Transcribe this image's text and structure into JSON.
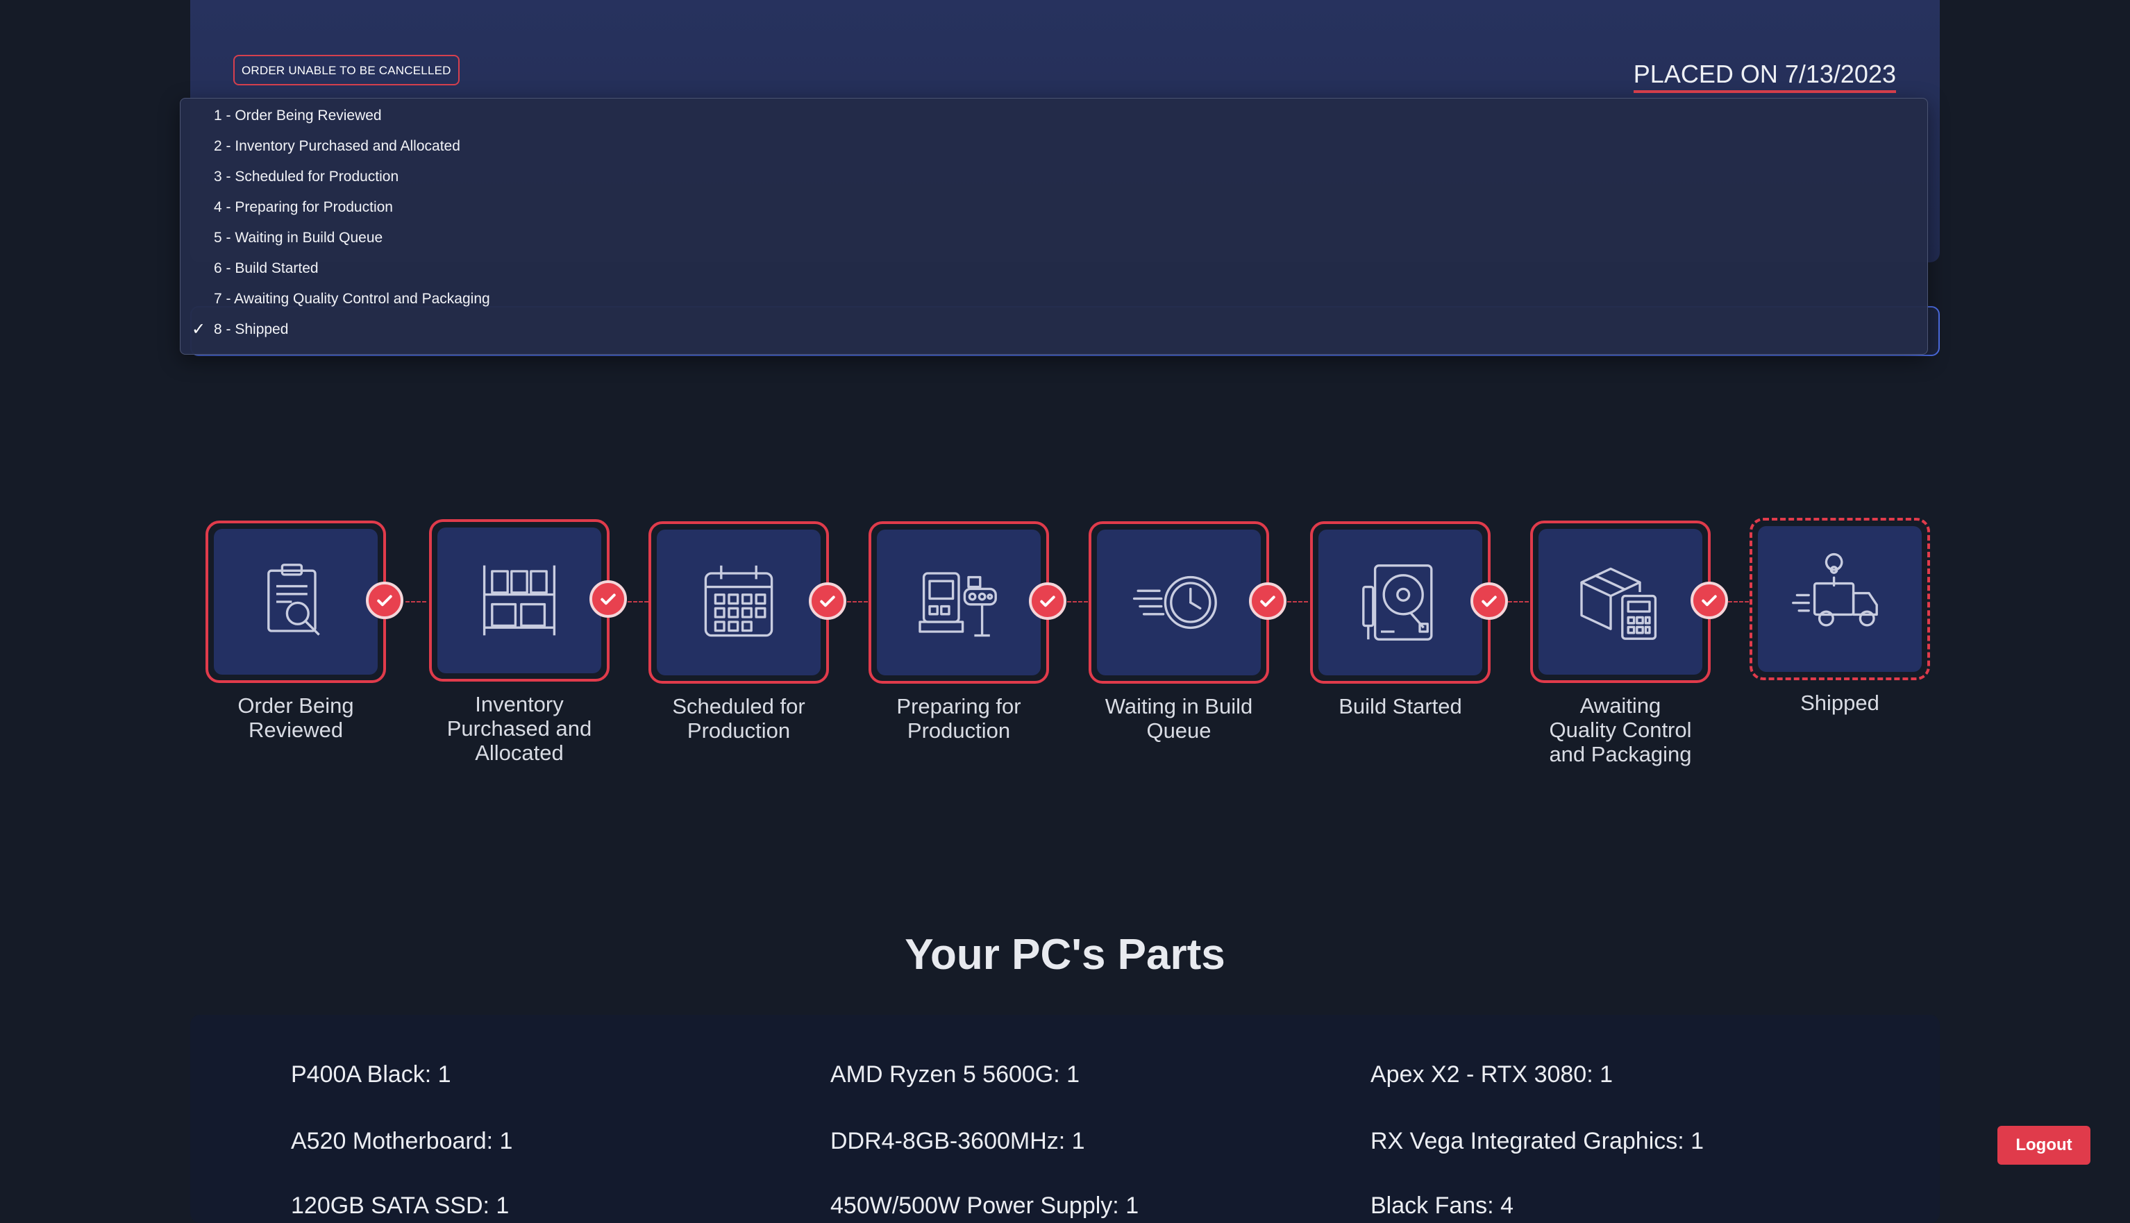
{
  "order": {
    "cancel_badge": "ORDER UNABLE TO BE CANCELLED",
    "placed_on": "PLACED ON 7/13/2023"
  },
  "dropdown": {
    "options": [
      "1 - Order Being Reviewed",
      "2 - Inventory Purchased and Allocated",
      "3 - Scheduled for Production",
      "4 - Preparing for Production",
      "5 - Waiting in Build Queue",
      "6 - Build Started",
      "7 - Awaiting Quality Control and Packaging",
      "8 - Shipped"
    ],
    "selected": "8 - Shipped",
    "check_glyph": "✓"
  },
  "steps": [
    {
      "label_lines": [
        "Order Being",
        "Reviewed"
      ],
      "icon": "clipboard-search-icon",
      "complete": true
    },
    {
      "label_lines": [
        "Inventory",
        "Purchased and",
        "Allocated"
      ],
      "icon": "warehouse-shelf-icon",
      "complete": true
    },
    {
      "label_lines": [
        "Scheduled for",
        "Production"
      ],
      "icon": "calendar-icon",
      "complete": true
    },
    {
      "label_lines": [
        "Preparing for",
        "Production"
      ],
      "icon": "machine-icon",
      "complete": true
    },
    {
      "label_lines": [
        "Waiting in Build",
        "Queue"
      ],
      "icon": "fast-clock-icon",
      "complete": true
    },
    {
      "label_lines": [
        "Build Started"
      ],
      "icon": "hard-drive-icon",
      "complete": true
    },
    {
      "label_lines": [
        "Awaiting",
        "Quality Control",
        "and Packaging"
      ],
      "icon": "box-calculator-icon",
      "complete": true
    },
    {
      "label_lines": [
        "Shipped"
      ],
      "icon": "delivery-truck-icon",
      "complete": false
    }
  ],
  "parts": {
    "title": "Your PC's Parts",
    "items": [
      "P400A Black: 1",
      "AMD Ryzen 5 5600G: 1",
      "Apex X2 - RTX 3080: 1",
      "A520 Motherboard: 1",
      "DDR4-8GB-3600MHz: 1",
      "RX Vega Integrated Graphics: 1",
      "120GB SATA SSD: 1",
      "450W/500W Power Supply: 1",
      "Black Fans: 4"
    ]
  },
  "logout_label": "Logout",
  "colors": {
    "accent_red": "#e03b4b",
    "panel_blue": "#233063",
    "background": "#151b27"
  }
}
